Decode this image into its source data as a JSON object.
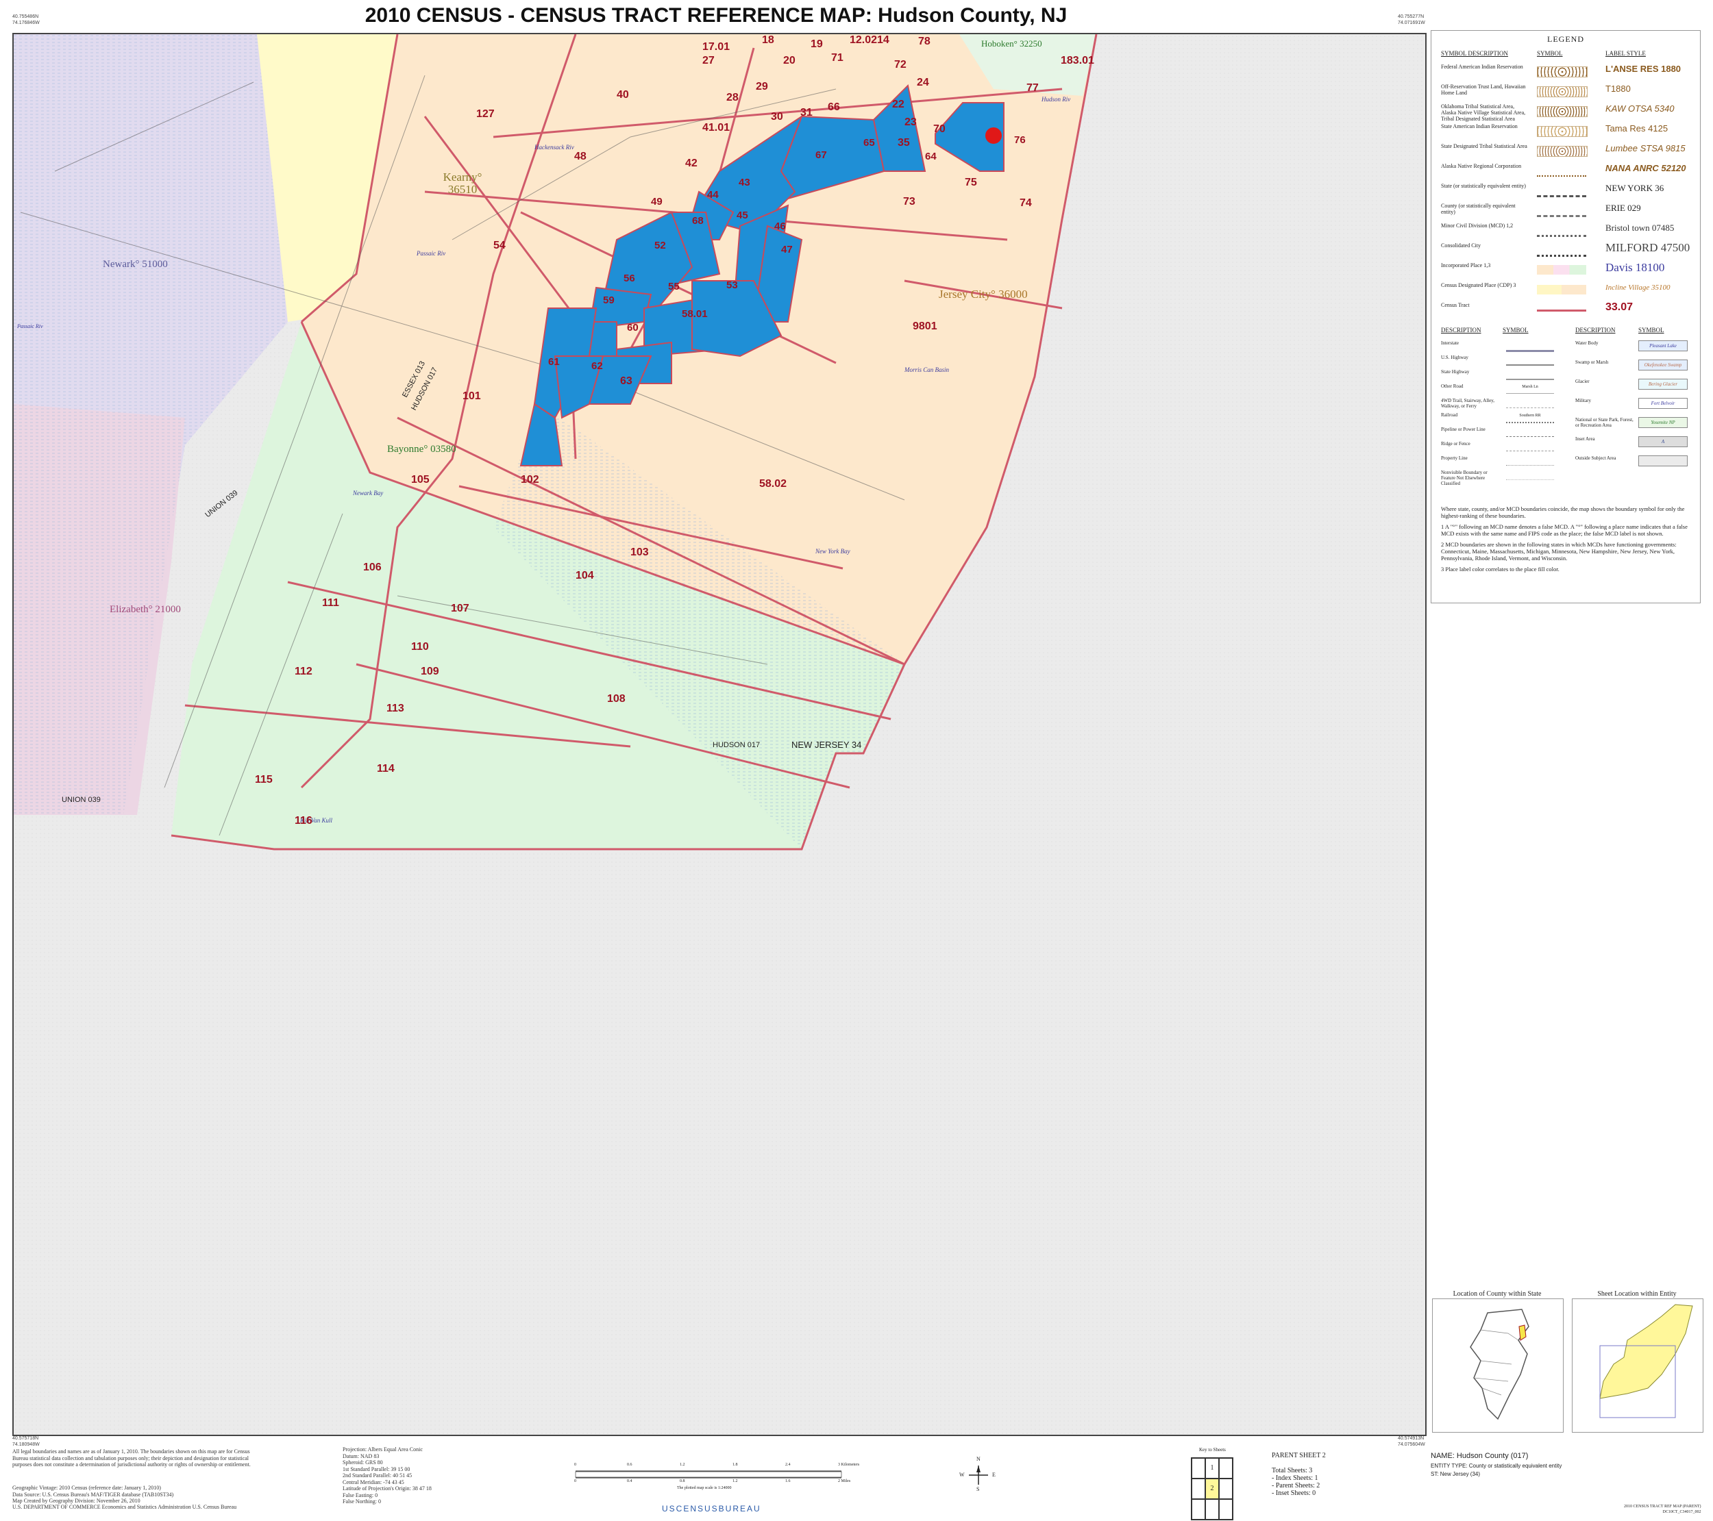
{
  "title": "2010 CENSUS - CENSUS TRACT REFERENCE MAP:  Hudson County, NJ",
  "corners": {
    "top_left": [
      "40.755486N",
      "74.176846W"
    ],
    "top_right": [
      "40.755277N",
      "74.071691W"
    ],
    "bottom_left": [
      "40.575718N",
      "74.180948W"
    ],
    "bottom_right": [
      "40.574913N",
      "74.075604W"
    ]
  },
  "places": [
    {
      "name": "Kearny° 36510"
    },
    {
      "name": "Newark° 51000"
    },
    {
      "name": "Hoboken° 32250"
    },
    {
      "name": "Jersey City° 36000"
    },
    {
      "name": "Bayonne° 03580"
    },
    {
      "name": "Elizabeth° 21000"
    }
  ],
  "county_labels": [
    "ESSEX 013",
    "HUDSON 017",
    "UNION 039",
    "HUDSON 017",
    "NEW JERSEY 34",
    "UNION 039"
  ],
  "water_labels": [
    "Hackensack Riv",
    "Passaic Riv",
    "Newark Bay",
    "New York Bay",
    "Hudson Riv",
    "Morris Can Basin",
    "Kill Van Kull",
    "Passaic Riv"
  ],
  "tracts": [
    "17.01",
    "18",
    "19",
    "27",
    "20",
    "71",
    "12.02",
    "14",
    "78",
    "72",
    "24",
    "183.01",
    "40",
    "127",
    "29",
    "28",
    "30",
    "31",
    "66",
    "22",
    "77",
    "23",
    "70",
    "76",
    "41.01",
    "65",
    "35",
    "64",
    "48",
    "42",
    "67",
    "43",
    "75",
    "44",
    "49",
    "73",
    "74",
    "68",
    "45",
    "46",
    "54",
    "52",
    "47",
    "56",
    "55",
    "53",
    "59",
    "58.01",
    "9801",
    "60",
    "61",
    "62",
    "63",
    "101",
    "102",
    "58.02",
    "105",
    "103",
    "106",
    "104",
    "111",
    "107",
    "110",
    "112",
    "109",
    "108",
    "113",
    "114",
    "115",
    "116"
  ],
  "selected_tracts": [
    "67",
    "65",
    "64",
    "76",
    "44",
    "43",
    "45",
    "68",
    "49",
    "52",
    "46",
    "47",
    "56",
    "55",
    "53",
    "59",
    "58.01",
    "60",
    "61",
    "62"
  ],
  "legend": {
    "title": "LEGEND",
    "headers": {
      "desc": "SYMBOL DESCRIPTION",
      "symbol": "SYMBOL",
      "style": "LABEL STYLE"
    },
    "rows": [
      {
        "desc": "Federal American Indian Reservation",
        "style": "L'ANSE RES 1880",
        "color": "#8a5a1e"
      },
      {
        "desc": "Off-Reservation Trust Land, Hawaiian Home Land",
        "style": "T1880",
        "color": "#8a5a1e"
      },
      {
        "desc": "Oklahoma Tribal Statistical Area, Alaska Native Village Statistical Area, Tribal Designated Statistical Area",
        "style": "KAW OTSA 5340",
        "color": "#8a5a1e"
      },
      {
        "desc": "State American Indian Reservation",
        "style": "Tama Res 4125",
        "color": "#8a5a1e"
      },
      {
        "desc": "State Designated Tribal Statistical Area",
        "style": "Lumbee STSA 9815",
        "color": "#8a5a1e"
      },
      {
        "desc": "Alaska Native Regional Corporation",
        "style": "NANA ANRC 52120",
        "color": "#8a5a1e"
      },
      {
        "desc": "State (or statistically equivalent entity)",
        "style": "NEW YORK 36",
        "color": "#222222"
      },
      {
        "desc": "County (or statistically equivalent entity)",
        "style": "ERIE 029",
        "color": "#222222"
      },
      {
        "desc": "Minor Civil Division (MCD) 1,2",
        "style": "Bristol town 07485",
        "color": "#333333"
      },
      {
        "desc": "Consolidated City",
        "style": "MILFORD 47500",
        "color": "#444444"
      },
      {
        "desc": "Incorporated Place 1,3",
        "style": "Davis 18100",
        "color": "#3b3b9e"
      },
      {
        "desc": "Census Designated Place (CDP) 3",
        "style": "Incline Village 35100",
        "color": "#b8762a"
      },
      {
        "desc": "Census Tract",
        "style": "33.07",
        "color": "#a01020"
      }
    ],
    "headers2": {
      "desc": "DESCRIPTION",
      "symbol": "SYMBOL"
    },
    "rows_left": [
      {
        "desc": "Interstate"
      },
      {
        "desc": "U.S. Highway"
      },
      {
        "desc": "State Highway"
      },
      {
        "desc": "Other Road",
        "sample": "Marsh Ln"
      },
      {
        "desc": "4WD Trail, Stairway, Alley, Walkway, or Ferry"
      },
      {
        "desc": "Railroad",
        "sample": "Southern RR"
      },
      {
        "desc": "Pipeline or Power Line"
      },
      {
        "desc": "Ridge or Fence"
      },
      {
        "desc": "Property Line"
      },
      {
        "desc": "Nonvisible Boundary or Feature Not Elsewhere Classified"
      }
    ],
    "rows_right": [
      {
        "desc": "Water Body",
        "sample": "Pleasant Lake",
        "fill": "#e4eefc",
        "ink": "#3b3b9e"
      },
      {
        "desc": "Swamp or Marsh",
        "sample": "Okefenokee Swamp",
        "fill": "#e4eefc",
        "ink": "#b86a4a"
      },
      {
        "desc": "Glacier",
        "sample": "Bering Glacier",
        "fill": "#e9f8fb",
        "ink": "#b86a4a"
      },
      {
        "desc": "Military",
        "sample": "Fort Belvoir",
        "fill": "#ffffff",
        "ink": "#3b3b9e"
      },
      {
        "desc": "National or State Park, Forest, or Recreation Area",
        "sample": "Yosemite NP",
        "fill": "#eaf7e6",
        "ink": "#2c7a2c"
      },
      {
        "desc": "Inset Area",
        "sample": "A",
        "fill": "#dddddd",
        "ink": "#2a3f8a"
      },
      {
        "desc": "Outside Subject Area",
        "sample": "",
        "fill": "#ebebeb",
        "ink": "#333333"
      }
    ],
    "notes": [
      "Where state, county, and/or MCD boundaries coincide, the map shows the boundary symbol for only the highest-ranking of these boundaries.",
      "1  A \"°\" following an MCD name denotes a false MCD.  A \"°\" following a place name indicates that a false MCD exists with the same name and FIPS code as the place; the false MCD label is not shown.",
      "2  MCD boundaries are shown in the following states in which MCDs have functioning governments: Connecticut, Maine, Massachusetts, Michigan, Minnesota, New Hampshire, New Jersey, New York, Pennsylvania, Rhode Island, Vermont, and Wisconsin.",
      "3  Place label color correlates to the place fill color."
    ]
  },
  "insets": {
    "left_title": "Location of County within State",
    "right_title": "Sheet Location within Entity"
  },
  "footer": {
    "disclaimer": "All legal boundaries and names are as of January 1, 2010. The boundaries shown on this map are for Census Bureau statistical data collection and tabulation purposes only; their depiction and designation for statistical purposes does not constitute a determination of jurisdictional authority or rights of ownership or entitlement.",
    "vintage_lines": [
      "Geographic Vintage: 2010 Census (reference date: January 1, 2010)",
      "Data Source: U.S. Census Bureau's MAF/TIGER database (TAB10ST34)",
      "Map Created by Geography Division: November 26, 2010"
    ],
    "dept": "U.S. DEPARTMENT OF COMMERCE Economics and Statistics Administration U.S. Census Bureau",
    "projection_lines": [
      "Projection: Albers Equal Area Conic",
      "Datum: NAD 83",
      "Spheroid: GRS 80",
      "1st Standard Parallel: 39 15 00",
      "2nd Standard Parallel: 40 51 45",
      "Central Meridian: -74 43 45",
      "Latitude of Projection's Origin: 38 47 18",
      "False Easting: 0",
      "False Northing: 0"
    ],
    "scale_km_ticks": [
      "0",
      "0.6",
      "1.2",
      "1.8",
      "2.4",
      "3 Kilometers"
    ],
    "scale_mi_ticks": [
      "0",
      "0.4",
      "0.8",
      "1.2",
      "1.6",
      "2 Miles"
    ],
    "scale_note": "The plotted map scale is 1:24000",
    "census_logo": "USCENSUSBUREAU",
    "compass": {
      "n": "N",
      "s": "S",
      "e": "E",
      "w": "W"
    },
    "key_title": "Key to Sheets",
    "key_cells": [
      "1",
      "2"
    ],
    "parent_sheet": "PARENT SHEET 2",
    "sheet_totals": [
      "Total Sheets: 3",
      " - Index Sheets: 1",
      " - Parent Sheets: 2",
      " - Inset Sheets: 0"
    ],
    "name_line": "NAME: Hudson County (017)",
    "entity_line": "ENTITY TYPE: County or statistically equivalent entity",
    "state_line": "ST: New Jersey (34)",
    "map_id": "2010 CENSUS TRACT REF MAP (PARENT)",
    "map_code": "DC10CT_C34017_002"
  }
}
